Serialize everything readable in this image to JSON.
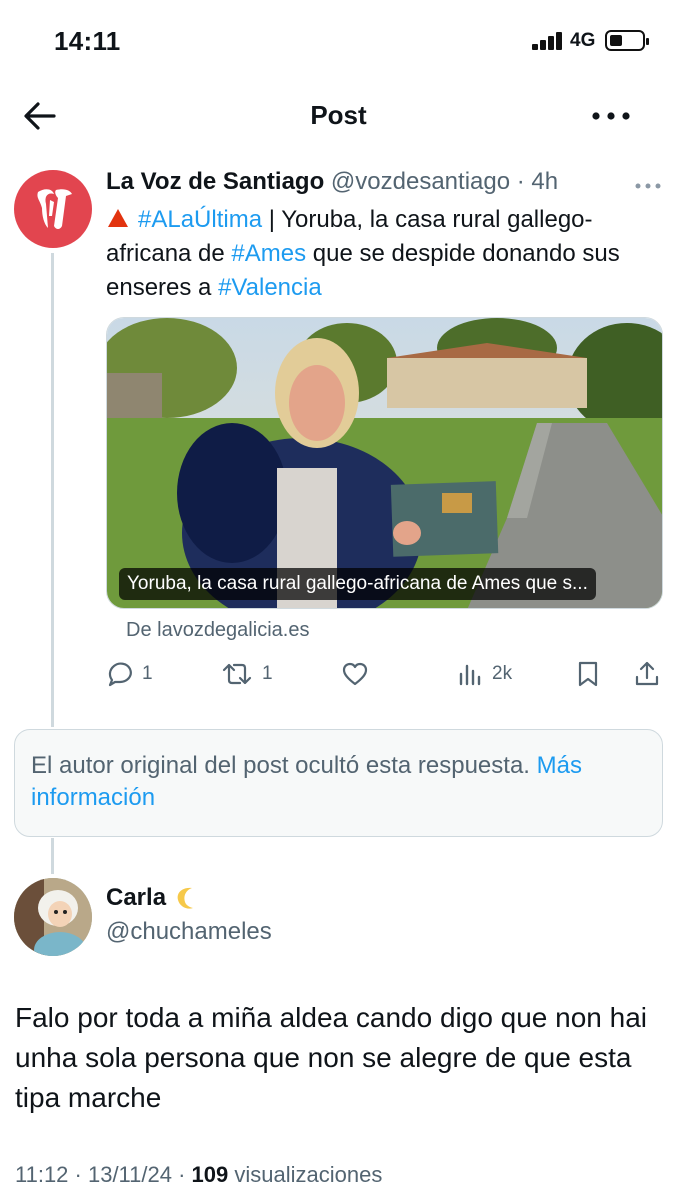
{
  "status_bar": {
    "time": "14:11",
    "network": "4G"
  },
  "header": {
    "title": "Post"
  },
  "tweet": {
    "display_name": "La Voz de Santiago",
    "handle": "@vozdesantiago",
    "time": "4h",
    "text_parts": {
      "hashtag1": "#ALaÚltima",
      "t1": " | Yoruba, la casa rural gallego-africana de ",
      "hashtag2": "#Ames",
      "t2": " que se despide donando sus enseres a ",
      "hashtag3": "#Valencia"
    },
    "card_caption": "Yoruba, la casa rural gallego-africana de Ames que s...",
    "card_source": "De lavozdegalicia.es",
    "replies": "1",
    "reposts": "1",
    "views": "2k"
  },
  "hidden_notice": {
    "text": "El autor original del post ocultó esta respuesta. ",
    "link": "Más información"
  },
  "reply": {
    "display_name": "Carla",
    "handle": "@chuchameles",
    "text": "Falo por toda a miña aldea cando digo que non hai unha sola persona que non se alegre de que esta tipa marche",
    "date": "11:12 · 13/11/24 · ",
    "views_count": "109",
    "views_label": " visualizaciones"
  },
  "icons": [
    "back-arrow-icon",
    "more-icon",
    "warning-icon",
    "reply-icon",
    "repost-icon",
    "like-icon",
    "views-icon",
    "bookmark-icon",
    "share-icon",
    "moon-icon"
  ],
  "colors": {
    "link": "#1d9bf0",
    "secondary_text": "#536471",
    "avatar_red": "#e2454f"
  }
}
